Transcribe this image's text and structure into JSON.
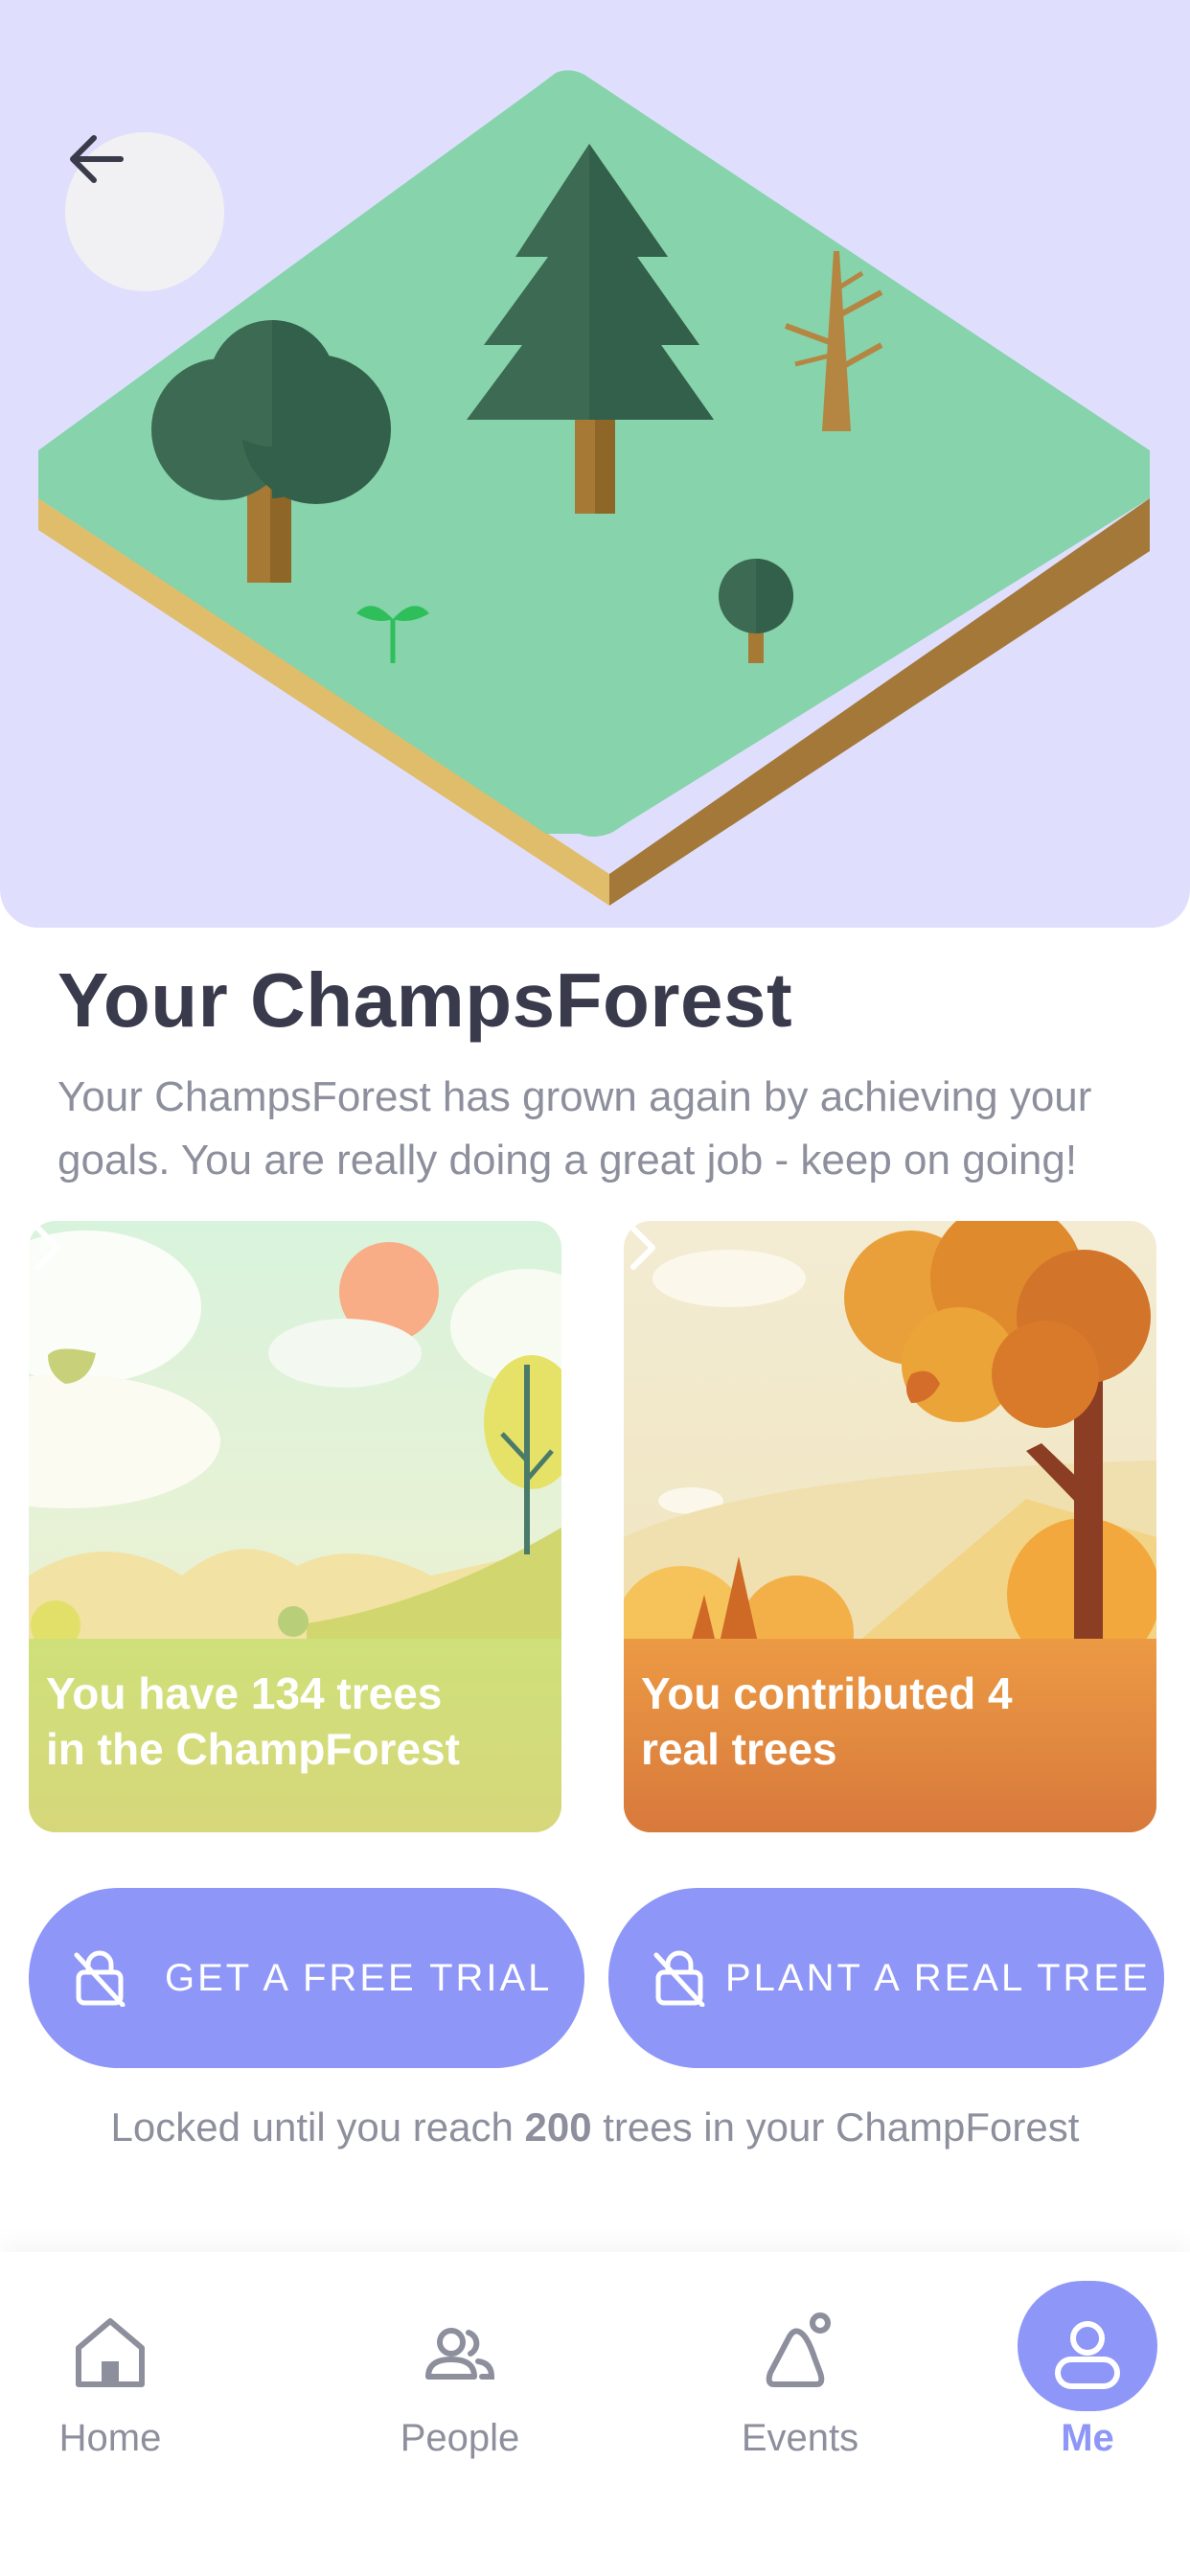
{
  "header": {
    "back_icon": "arrow-left-icon"
  },
  "page": {
    "title": "Your ChampsForest",
    "subtitle": "Your ChampsForest has grown again by achieving your goals. You are really doing a great job - keep on going!"
  },
  "cards": [
    {
      "text_line1": "You have 134 trees",
      "text_line2": "in the ChampForest",
      "icon": "chevron-right-icon"
    },
    {
      "text_line1": "You contributed 4",
      "text_line2": "real trees",
      "icon": "chevron-right-icon"
    }
  ],
  "actions": [
    {
      "label": "GET A FREE TRIAL",
      "icon": "lock-open-icon"
    },
    {
      "label": "PLANT A REAL TREE",
      "icon": "lock-open-icon"
    }
  ],
  "locked_note": {
    "prefix": "Locked until you reach ",
    "count": "200",
    "suffix": " trees in your ChampForest"
  },
  "tabbar": {
    "items": [
      {
        "label": "Home",
        "icon": "home-icon"
      },
      {
        "label": "People",
        "icon": "people-icon"
      },
      {
        "label": "Events",
        "icon": "events-icon"
      },
      {
        "label": "Me",
        "icon": "user-icon",
        "active": true
      }
    ]
  },
  "colors": {
    "accent": "#8e96f7",
    "hero_bg": "#dfdffd",
    "title": "#393a4c",
    "muted": "#8d8f9d",
    "grass": "#87d3ac"
  }
}
